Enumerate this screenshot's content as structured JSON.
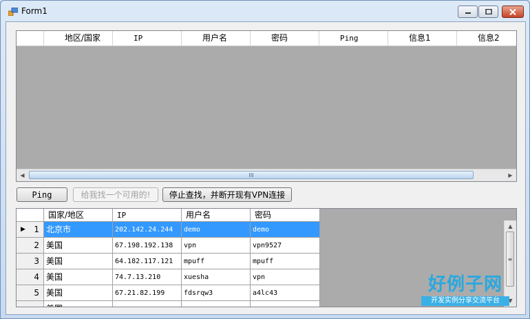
{
  "window": {
    "title": "Form1"
  },
  "grid1": {
    "columns": [
      "地区/国家",
      "IP",
      "用户名",
      "密码",
      "Ping",
      "信息1",
      "信息2"
    ],
    "scroll_thumb_glyph": "III"
  },
  "buttons": {
    "ping": "Ping",
    "find": "给我找一个可用的!",
    "stop": "停止查找，并断开现有VPN连接"
  },
  "grid2": {
    "columns": [
      "国家/地区",
      "IP",
      "用户名",
      "密码"
    ],
    "rows": [
      {
        "num": "1",
        "country": "北京市",
        "ip": "202.142.24.244",
        "user": "demo",
        "pass": "demo"
      },
      {
        "num": "2",
        "country": "美国",
        "ip": "67.198.192.138",
        "user": "vpn",
        "pass": "vpn9527"
      },
      {
        "num": "3",
        "country": "美国",
        "ip": "64.182.117.121",
        "user": "mpuff",
        "pass": "mpuff"
      },
      {
        "num": "4",
        "country": "美国",
        "ip": "74.7.13.210",
        "user": "xuesha",
        "pass": "vpn"
      },
      {
        "num": "5",
        "country": "美国",
        "ip": "67.21.82.199",
        "user": "fdsrqw3",
        "pass": "a4lc43"
      },
      {
        "num": "",
        "country": "美国",
        "ip": "",
        "user": "",
        "pass": ""
      }
    ]
  },
  "watermark": {
    "main": "好例子网",
    "sub": "开发实例分享交流平台"
  }
}
